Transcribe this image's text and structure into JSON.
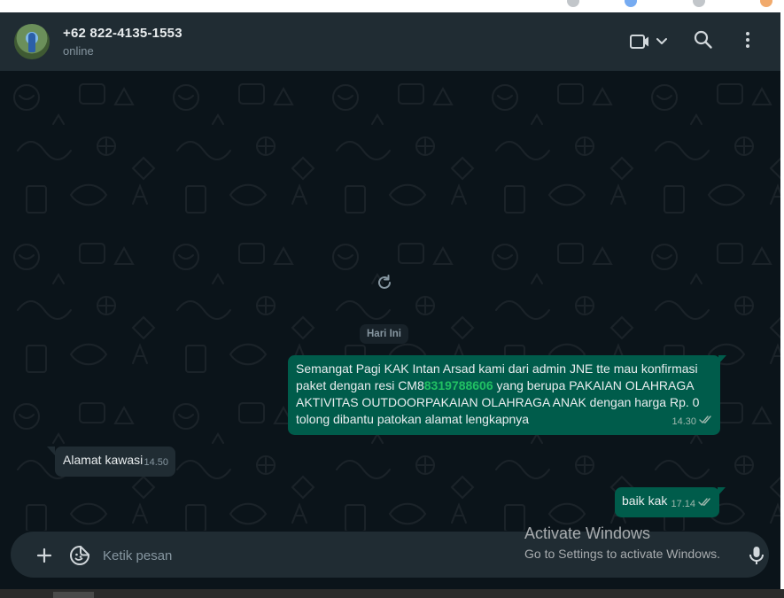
{
  "contact": {
    "name": "+62 822-4135-1553",
    "status": "online"
  },
  "header_icons": [
    "video-call-icon",
    "chevron-down-icon",
    "search-icon",
    "menu-icon"
  ],
  "date_divider": "Hari Ini",
  "messages": [
    {
      "direction": "outgoing",
      "text_before": "Semangat Pagi KAK Intan Arsad kami dari admin JNE tte mau konfirmasi paket dengan resi CM8",
      "highlight": "8319788606",
      "text_after": " yang berupa PAKAIAN OLAHRAGA AKTIVITAS OUTDOORPAKAIAN OLAHRAGA ANAK dengan harga Rp. 0 tolong dibantu patokan alamat lengkapnya",
      "time": "14.30",
      "status": "read"
    },
    {
      "direction": "incoming",
      "text": "Alamat kawasi",
      "time": "14.50"
    },
    {
      "direction": "outgoing",
      "text": "baik kak",
      "time": "17.14",
      "status": "read"
    }
  ],
  "composer": {
    "placeholder": "Ketik pesan"
  },
  "watermark": {
    "title": "Activate Windows",
    "subtitle": "Go to Settings to activate Windows."
  },
  "colors": {
    "header_bg": "#202c33",
    "chat_bg": "#0b141a",
    "outgoing_bubble": "#005c4b",
    "incoming_bubble": "#202c33",
    "tracking_number": "#21c063"
  }
}
